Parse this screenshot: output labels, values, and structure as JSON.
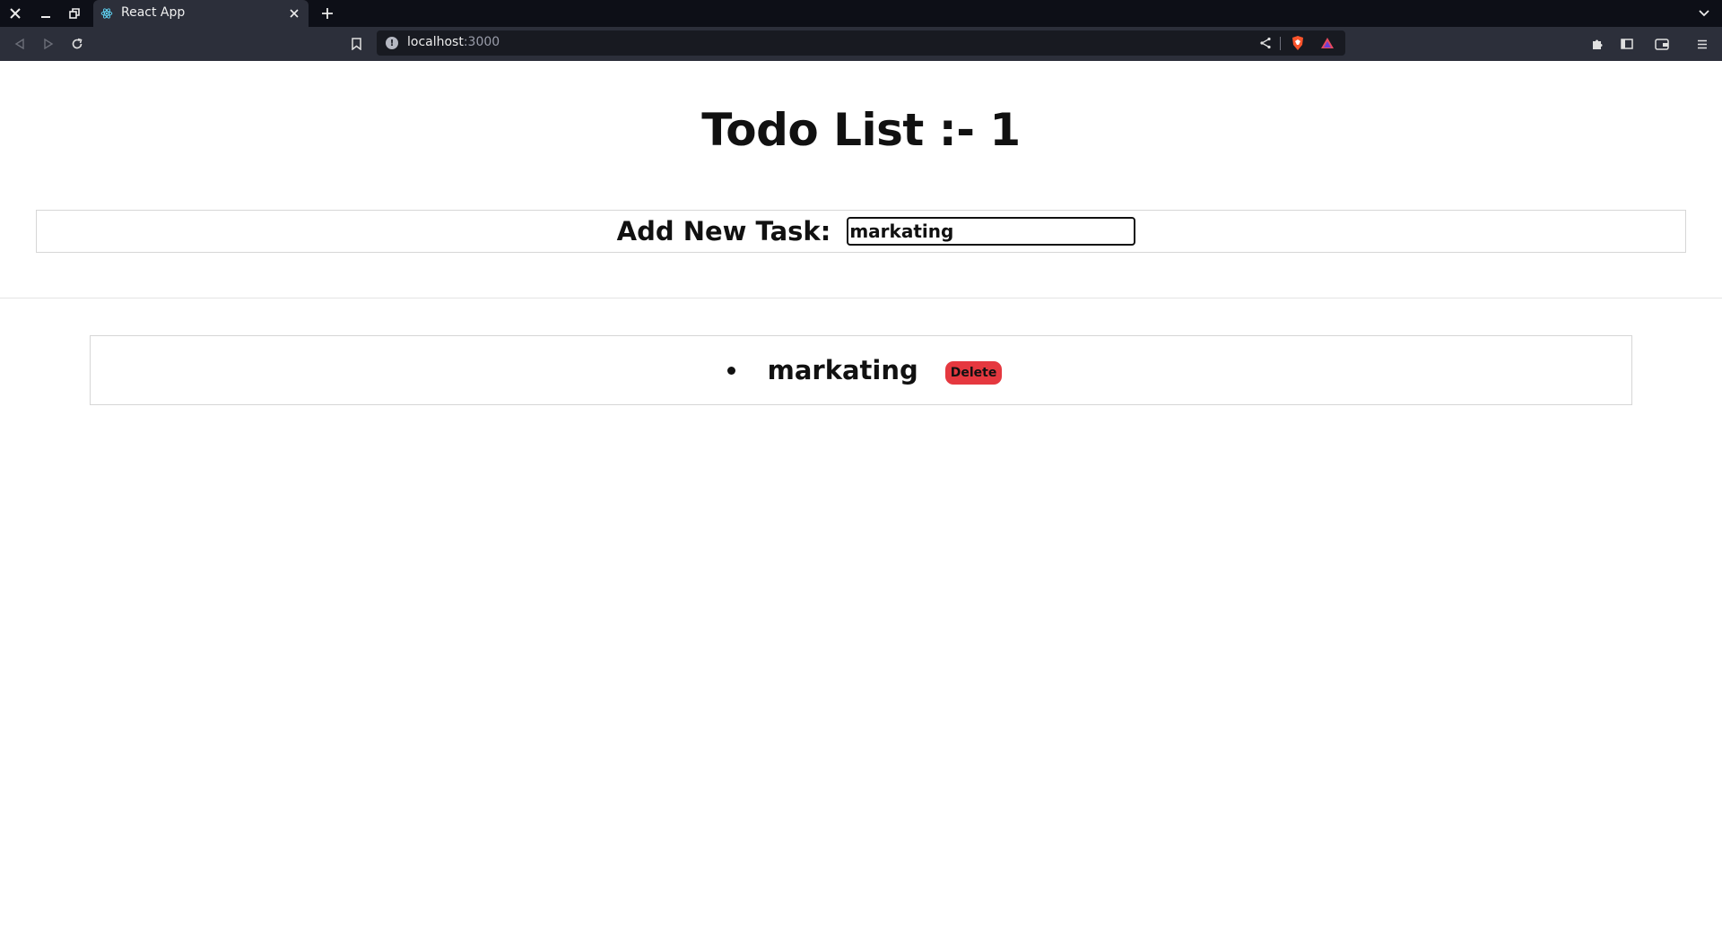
{
  "browser": {
    "tab_title": "React App",
    "url_host": "localhost",
    "url_port": ":3000",
    "icons": {
      "close_window": "close-icon",
      "minimize": "minimize-icon",
      "restore": "restore-icon",
      "tab_favicon": "react-icon",
      "tab_close": "close-icon",
      "new_tab": "plus-icon",
      "tab_list": "chevron-down-icon",
      "back": "back-icon",
      "forward": "forward-icon",
      "reload": "reload-icon",
      "bookmark": "bookmark-icon",
      "site_info": "info-icon",
      "share": "share-icon",
      "brave_shields": "brave-shield-icon",
      "rewards": "rewards-triangle-icon",
      "extensions": "puzzle-icon",
      "sidebar": "sidebar-icon",
      "wallet": "wallet-icon",
      "menu": "menu-icon"
    },
    "colors": {
      "titlebar": "#0d0f17",
      "toolbar": "#2c2f3a",
      "urlbar": "#181a21"
    }
  },
  "app": {
    "title_text": "Todo List :-",
    "task_count": "1",
    "form": {
      "label": "Add New Task:",
      "input_value": "markating"
    },
    "tasks": [
      {
        "text": "markating",
        "delete_label": "Delete"
      }
    ],
    "colors": {
      "delete_button": "#e5383f",
      "text": "#111111"
    }
  }
}
